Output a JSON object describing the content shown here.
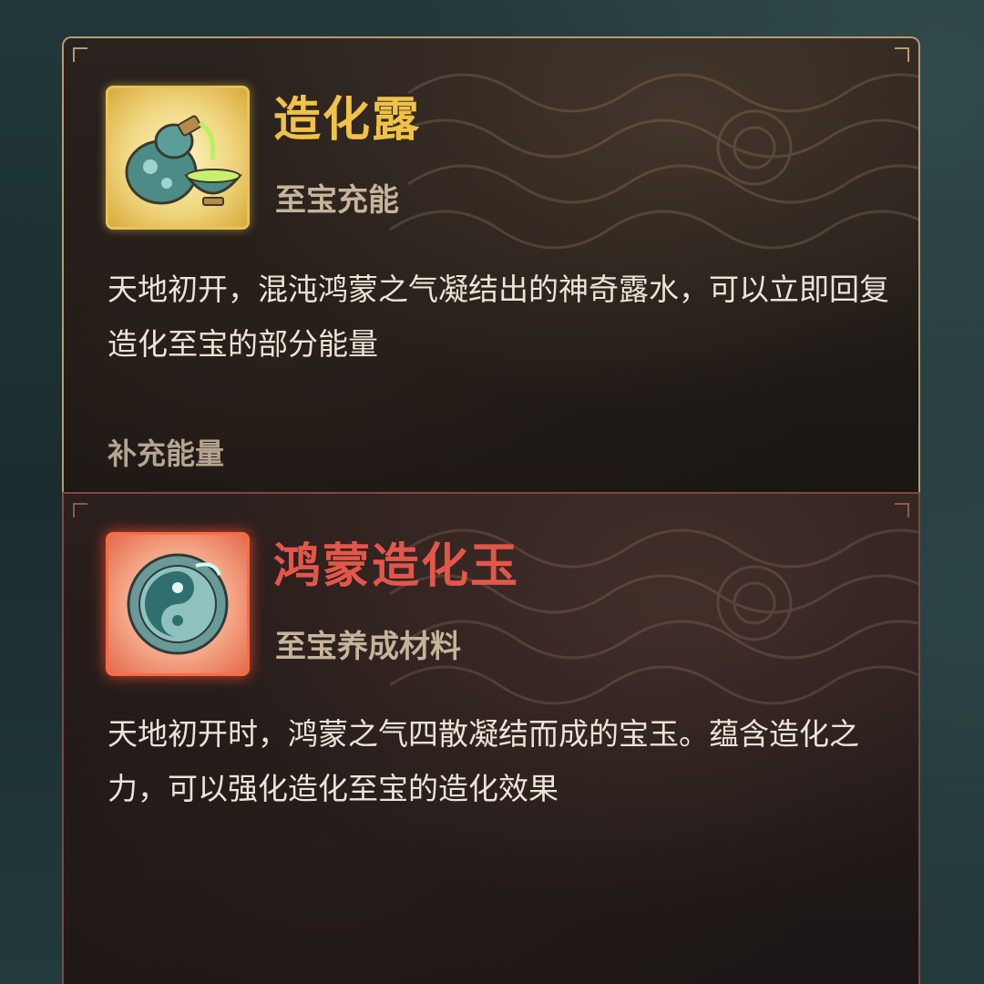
{
  "items": [
    {
      "name": "造化露",
      "type": "至宝充能",
      "description": "天地初开，混沌鸿蒙之气凝结出的神奇露水，可以立即回复造化至宝的部分能量",
      "action": "补充能量",
      "rarity_color": "#f0c346",
      "icon": "gourd-and-bowl-icon"
    },
    {
      "name": "鸿蒙造化玉",
      "type": "至宝养成材料",
      "description": "天地初开时，鸿蒙之气四散凝结而成的宝玉。蕴含造化之力，可以强化造化至宝的造化效果",
      "rarity_color": "#e4564a",
      "icon": "jade-disc-icon"
    }
  ]
}
